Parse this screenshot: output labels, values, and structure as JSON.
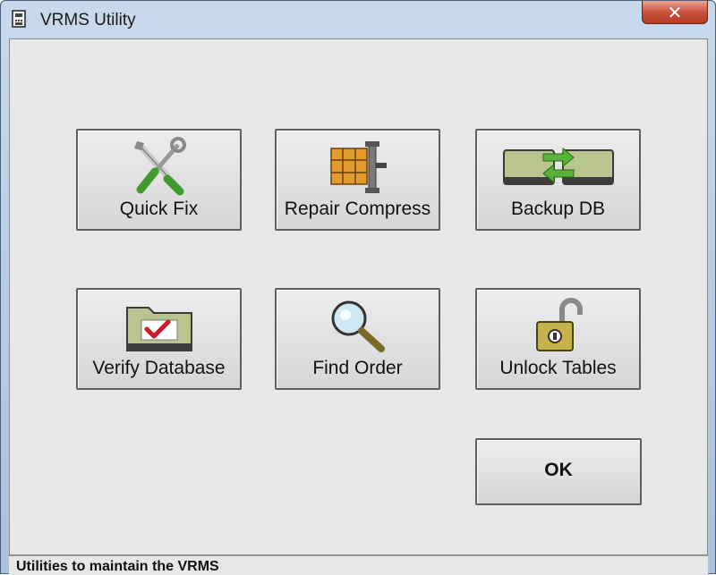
{
  "window": {
    "title": "VRMS Utility",
    "close_glyph": "✕"
  },
  "buttons": [
    {
      "label": "Quick Fix",
      "icon": "wrench-screwdriver-icon"
    },
    {
      "label": "Repair Compress",
      "icon": "compress-boxes-icon"
    },
    {
      "label": "Backup DB",
      "icon": "backup-drives-icon"
    },
    {
      "label": "Verify Database",
      "icon": "folder-check-icon"
    },
    {
      "label": "Find Order",
      "icon": "magnifier-icon"
    },
    {
      "label": "Unlock Tables",
      "icon": "open-padlock-icon"
    }
  ],
  "ok_label": "OK",
  "status_text": "Utilities to maintain the VRMS",
  "colors": {
    "client_bg": "#e7e7e7",
    "close_button": "#c9533d",
    "check_red": "#d11a2a",
    "arrow_green": "#59b33b"
  }
}
